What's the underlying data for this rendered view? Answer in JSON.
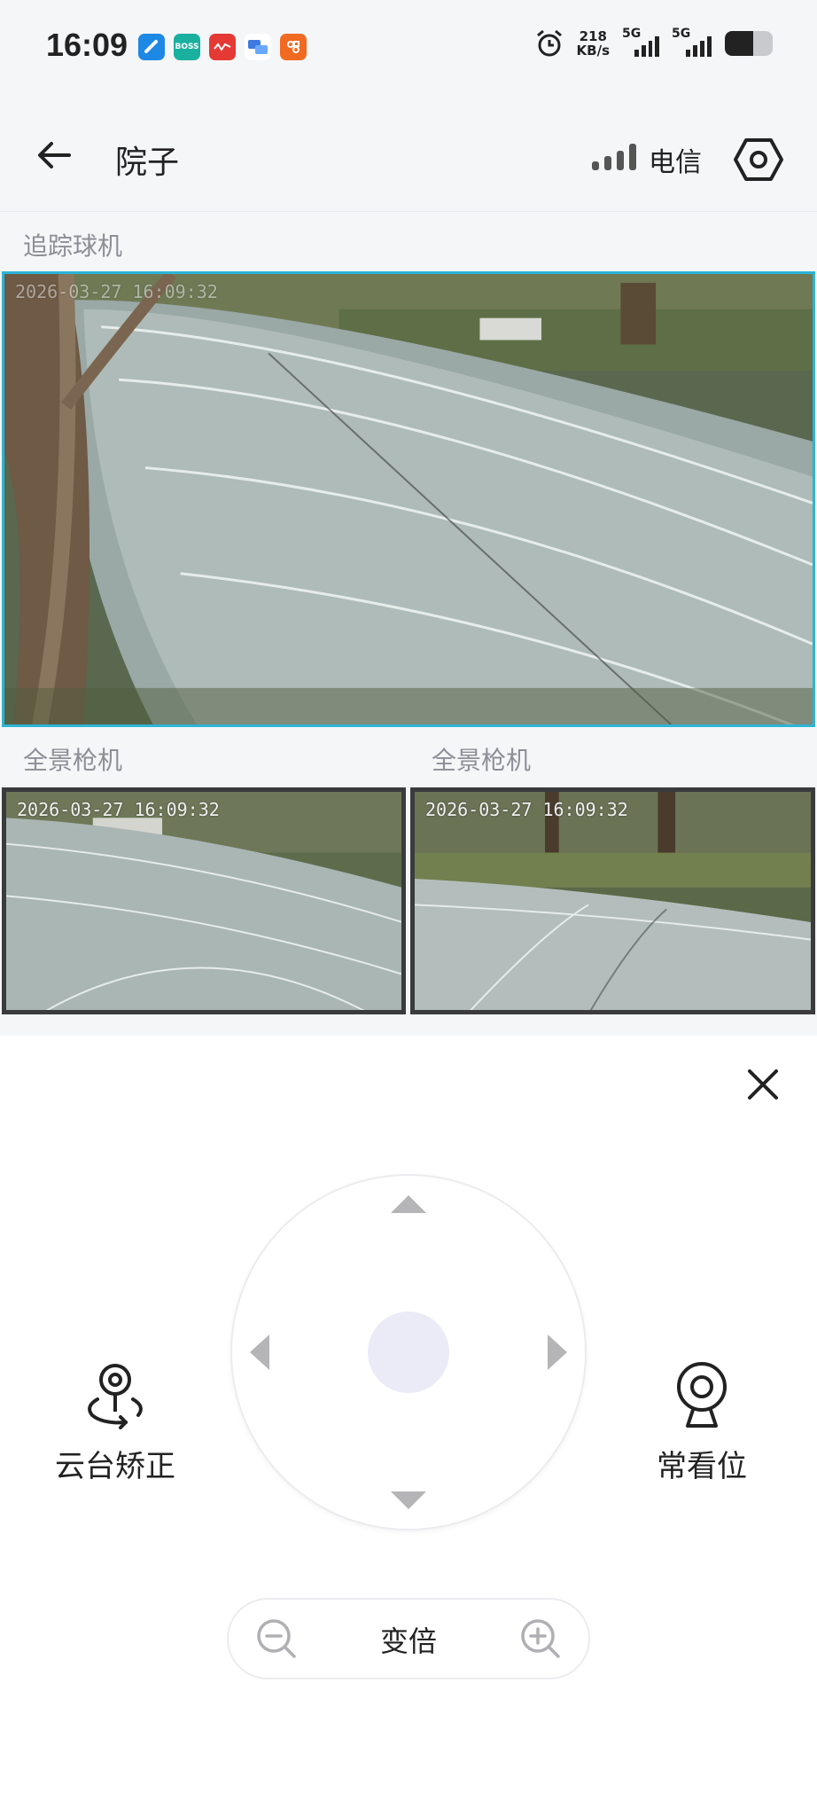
{
  "status_bar": {
    "time": "16:09",
    "net_speed_value": "218",
    "net_speed_unit": "KB/s",
    "sim1_label": "5G",
    "sim2_label": "5G",
    "battery_level": 0.6,
    "apps": [
      {
        "name": "app-icon-1",
        "text": "",
        "color": "#1e88e5"
      },
      {
        "name": "boss-app-icon",
        "text": "BOSS",
        "color": "#1ab0a0"
      },
      {
        "name": "app-icon-3",
        "text": "",
        "color": "#e53935"
      },
      {
        "name": "app-icon-4",
        "text": "",
        "color": "#3f7ae0"
      },
      {
        "name": "app-icon-5",
        "text": "",
        "color": "#f06a21"
      }
    ]
  },
  "header": {
    "title": "院子",
    "carrier": "电信",
    "signal_level": 4
  },
  "cameras": {
    "main": {
      "label": "追踪球机",
      "timestamp": "2026-03-27 16:09:32",
      "selected": true
    },
    "panoramic": [
      {
        "label": "全景枪机",
        "timestamp": "2026-03-27 16:09:32"
      },
      {
        "label": "全景枪机",
        "timestamp": "2026-03-27 16:09:32"
      }
    ]
  },
  "controls": {
    "ptz_calibrate_label": "云台矫正",
    "preset_label": "常看位",
    "zoom_label": "变倍"
  },
  "colors": {
    "accent": "#2db4d6",
    "joystick_center": "#ebebf7",
    "arrow": "#b5b5b8"
  }
}
